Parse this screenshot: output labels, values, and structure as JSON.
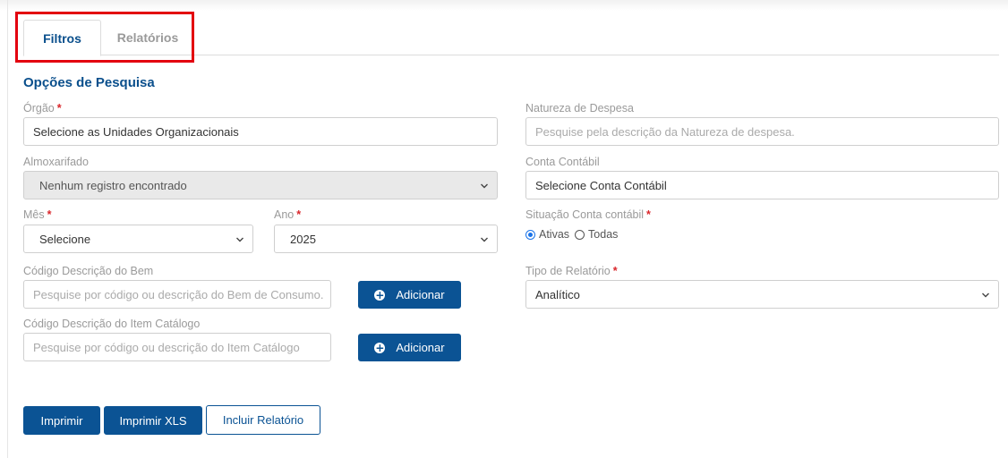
{
  "tabs": {
    "filtros": "Filtros",
    "relatorios": "Relatórios"
  },
  "section_title": "Opções de Pesquisa",
  "required_mark": "*",
  "orgao": {
    "label": "Órgão",
    "value": "Selecione as Unidades Organizacionais"
  },
  "natureza": {
    "label": "Natureza de Despesa",
    "placeholder": "Pesquise pela descrição da Natureza de despesa."
  },
  "almoxarifado": {
    "label": "Almoxarifado",
    "value": "Nenhum registro encontrado"
  },
  "conta_contabil": {
    "label": "Conta Contábil",
    "value": "Selecione Conta Contábil"
  },
  "mes": {
    "label": "Mês",
    "value": "Selecione"
  },
  "ano": {
    "label": "Ano",
    "value": "2025"
  },
  "situacao": {
    "label": "Situação Conta contábil",
    "options": [
      "Ativas",
      "Todas"
    ],
    "selected": "Ativas"
  },
  "codigo_bem": {
    "label": "Código Descrição do Bem",
    "placeholder": "Pesquise por código ou descrição do Bem de Consumo.",
    "add_label": "Adicionar"
  },
  "tipo_relatorio": {
    "label": "Tipo de Relatório",
    "value": "Analítico"
  },
  "codigo_item": {
    "label": "Código Descrição do Item Catálogo",
    "placeholder": "Pesquise por código ou descrição do Item Catálogo",
    "add_label": "Adicionar"
  },
  "actions": {
    "imprimir": "Imprimir",
    "imprimir_xls": "Imprimir XLS",
    "incluir_relatorio": "Incluir Relatório"
  },
  "colors": {
    "primary": "#0b5394",
    "title": "#0a4f8c",
    "required": "#d9262b",
    "highlight": "#e3000f"
  },
  "icons": {
    "chevron": "chevron-down-icon",
    "add": "plus-circle-icon"
  }
}
